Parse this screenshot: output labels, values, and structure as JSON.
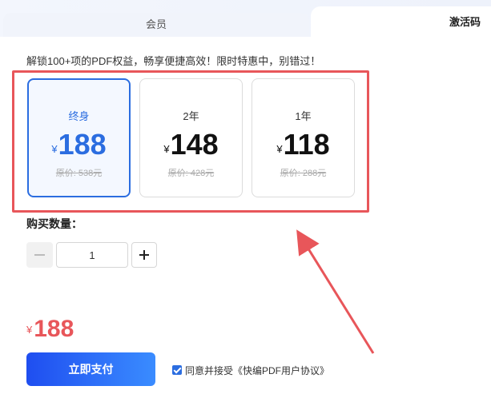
{
  "tabs": {
    "member": "会员",
    "activation_code": "激活码"
  },
  "promo_text": "解锁100+项的PDF权益，畅享便捷高效！限时特惠中，别错过！",
  "plans": [
    {
      "name": "终身",
      "currency": "¥",
      "price": "188",
      "original": "原价: 538元",
      "selected": true
    },
    {
      "name": "2年",
      "currency": "¥",
      "price": "148",
      "original": "原价: 428元",
      "selected": false
    },
    {
      "name": "1年",
      "currency": "¥",
      "price": "118",
      "original": "原价: 288元",
      "selected": false
    }
  ],
  "quantity": {
    "label": "购买数量：",
    "value": "1"
  },
  "total": {
    "currency": "¥",
    "amount": "188"
  },
  "pay_button": "立即支付",
  "agreement": {
    "checked": true,
    "text": "同意并接受《快编PDF用户协议》"
  },
  "colors": {
    "accent": "#2b6de0",
    "highlight": "#e8565a",
    "price_red": "#e8565a"
  }
}
